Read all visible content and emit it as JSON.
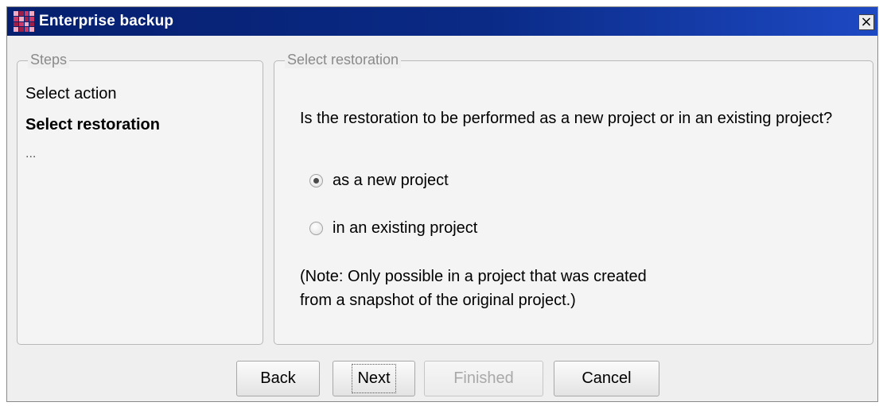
{
  "window": {
    "title": "Enterprise backup",
    "close_label": "×"
  },
  "steps_panel": {
    "legend": "Steps",
    "items": [
      {
        "label": "Select action"
      },
      {
        "label": "Select restoration"
      },
      {
        "label": "..."
      }
    ]
  },
  "restoration_panel": {
    "legend": "Select restoration",
    "question": "Is the restoration to be performed as a new project or in an existing project?",
    "options": [
      {
        "label": "as a new project",
        "checked": true
      },
      {
        "label": "in an existing project",
        "checked": false
      }
    ],
    "note_line1": "(Note: Only possible in a project that was created",
    "note_line2": "from a snapshot of the original project.)"
  },
  "buttons": {
    "back": "Back",
    "next": "Next",
    "finished": "Finished",
    "cancel": "Cancel"
  }
}
